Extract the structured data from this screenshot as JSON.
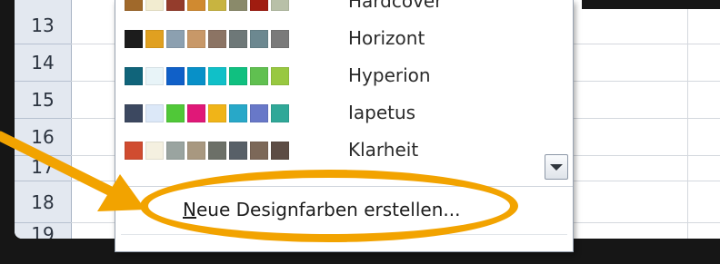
{
  "row_numbers": [
    "13",
    "14",
    "15",
    "16",
    "17",
    "18",
    "19"
  ],
  "themes": [
    {
      "name": "Hardcover",
      "colors": [
        "#a0692b",
        "#f2ecd0",
        "#943c2c",
        "#d08a30",
        "#c8b440",
        "#8a8a6a",
        "#a01c10",
        "#b8c0a8"
      ]
    },
    {
      "name": "Horizont",
      "colors": [
        "#1c1c1c",
        "#e0a020",
        "#8ca0b0",
        "#c89868",
        "#8c7464",
        "#6e7878",
        "#6c8890",
        "#7a7a7a"
      ]
    },
    {
      "name": "Hyperion",
      "colors": [
        "#10647a",
        "#e8f4f8",
        "#1060c8",
        "#0890c8",
        "#10c0c8",
        "#10c080",
        "#60c050",
        "#98c840"
      ]
    },
    {
      "name": "Iapetus",
      "colors": [
        "#3c4860",
        "#dce8f8",
        "#50c838",
        "#e01878",
        "#f0b418",
        "#28a8c8",
        "#6878c8",
        "#30a898"
      ]
    },
    {
      "name": "Klarheit",
      "colors": [
        "#d04c30",
        "#f4f0e0",
        "#9aa4a0",
        "#a89880",
        "#6c7068",
        "#586068",
        "#7c6858",
        "#5c4c44"
      ]
    }
  ],
  "menu": {
    "create_label_prefix": "N",
    "create_label_rest": "eue Designfarben erstellen..."
  },
  "annotation": {
    "highlight_color": "#f2a300"
  }
}
